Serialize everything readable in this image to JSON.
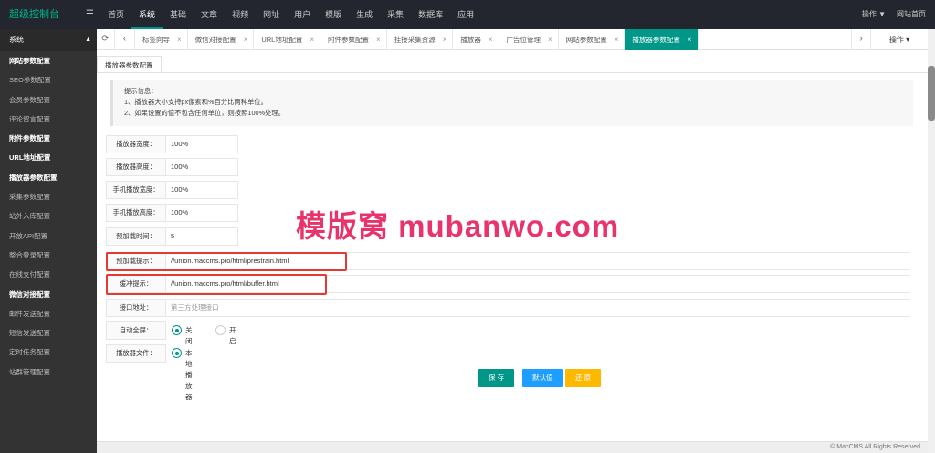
{
  "app": {
    "title": "超级控制台",
    "menu_toggle": "☰"
  },
  "nav": [
    "首页",
    "系统",
    "基础",
    "文章",
    "视频",
    "网址",
    "用户",
    "模版",
    "生成",
    "采集",
    "数据库",
    "应用"
  ],
  "nav_active": "系统",
  "top_right": {
    "ops": "操作 ▼",
    "home": "网站首页"
  },
  "sidebar": {
    "header": "系统",
    "items": [
      {
        "label": "网站参数配置",
        "strong": true
      },
      {
        "label": "SEO参数配置",
        "strong": false
      },
      {
        "label": "会员参数配置",
        "strong": false
      },
      {
        "label": "评论留言配置",
        "strong": false
      },
      {
        "label": "附件参数配置",
        "strong": true
      },
      {
        "label": "URL地址配置",
        "strong": true
      },
      {
        "label": "播放器参数配置",
        "strong": true
      },
      {
        "label": "采集参数配置",
        "strong": false
      },
      {
        "label": "站外入库配置",
        "strong": false
      },
      {
        "label": "开放API配置",
        "strong": false
      },
      {
        "label": "整合登录配置",
        "strong": false
      },
      {
        "label": "在线支付配置",
        "strong": false
      },
      {
        "label": "微信对接配置",
        "strong": true
      },
      {
        "label": "邮件发送配置",
        "strong": false
      },
      {
        "label": "短信发送配置",
        "strong": false
      },
      {
        "label": "定时任务配置",
        "strong": false
      },
      {
        "label": "站群管理配置",
        "strong": false
      }
    ]
  },
  "tabbar": {
    "refresh_icon": "⟳",
    "prev_icon": "‹",
    "next_icon": "›",
    "close_icon": "×",
    "ops_label": "操作 ▾",
    "tabs": [
      {
        "label": "标签向导",
        "active": false
      },
      {
        "label": "微信对接配置",
        "active": false
      },
      {
        "label": "URL地址配置",
        "active": false
      },
      {
        "label": "附件参数配置",
        "active": false
      },
      {
        "label": "挂接采集资源",
        "active": false
      },
      {
        "label": "播放器",
        "active": false
      },
      {
        "label": "广告位管理",
        "active": false
      },
      {
        "label": "网站参数配置",
        "active": false
      },
      {
        "label": "播放器参数配置",
        "active": true
      }
    ]
  },
  "page": {
    "subtab": "播放器参数配置",
    "tips": [
      "提示信息：",
      "1、播放器大小支持px像素和%百分比两种单位。",
      "2、如果设置的值不包含任何单位，则按照100%处理。"
    ]
  },
  "form": {
    "width": {
      "label": "播放器宽度：",
      "value": "100%"
    },
    "height": {
      "label": "播放器高度：",
      "value": "100%"
    },
    "mobile_width": {
      "label": "手机播放宽度：",
      "value": "100%"
    },
    "mobile_height": {
      "label": "手机播放高度：",
      "value": "100%"
    },
    "preload_time": {
      "label": "预加载时间：",
      "value": "5"
    },
    "preload_tip": {
      "label": "预加载提示：",
      "value": "//union.maccms.pro/html/prestrain.html"
    },
    "buffer_tip": {
      "label": "缓冲提示：",
      "value": "//union.maccms.pro/html/buffer.html"
    },
    "api_url": {
      "label": "接口地址：",
      "value": "",
      "placeholder": "第三方处理接口"
    },
    "autofull": {
      "label": "自动全屏：",
      "options": [
        "关闭",
        "开启"
      ],
      "selected": "关闭"
    },
    "player_file": {
      "label": "播放器文件：",
      "options": [
        "本地播放器"
      ],
      "selected": "本地播放器"
    }
  },
  "buttons": {
    "save": "保 存",
    "default": "默认值",
    "reset": "还 原"
  },
  "colors": {
    "primary": "#009688",
    "info": "#1e9fff",
    "warm": "#ffb800",
    "highlight": "#e53935",
    "watermark": "#e8336b"
  },
  "watermark": "模版窝 mubanwo.com",
  "footer": "© MacCMS All Rights Reserved."
}
